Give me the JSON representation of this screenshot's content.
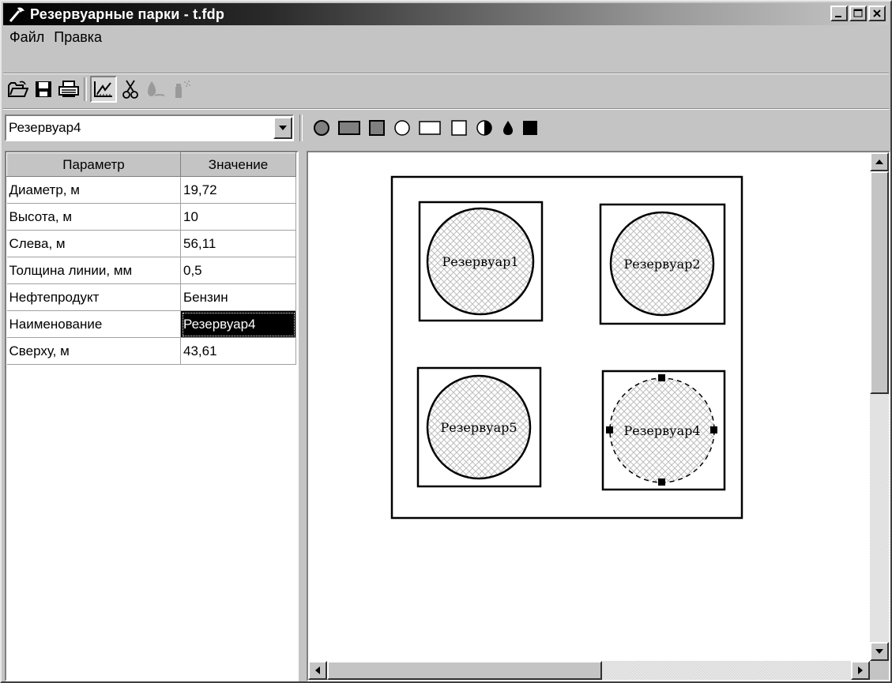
{
  "window": {
    "title": "Резервуарные парки - t.fdp"
  },
  "menu": [
    "Файл",
    "Правка"
  ],
  "toolbar": {
    "buttons": [
      "open-icon",
      "save-icon",
      "print-icon",
      "draw-mode-icon",
      "cut-icon",
      "fill-icon",
      "spray-icon"
    ]
  },
  "object_select": {
    "value": "Резервуар4"
  },
  "shape_palette": [
    "filled-circle",
    "filled-wide-rect",
    "filled-square",
    "hollow-circle",
    "hollow-wide-rect",
    "hollow-square",
    "half-circle",
    "drop",
    "black-square"
  ],
  "properties": {
    "headers": [
      "Параметр",
      "Значение"
    ],
    "rows": [
      {
        "param": "Диаметр, м",
        "value": "19,72"
      },
      {
        "param": "Высота, м",
        "value": "10"
      },
      {
        "param": "Слева, м",
        "value": "56,11"
      },
      {
        "param": "Толщина линии, мм",
        "value": "0,5"
      },
      {
        "param": "Нефтепродукт",
        "value": "Бензин"
      },
      {
        "param": "Наименование",
        "value": "Резервуар4"
      },
      {
        "param": "Сверху, м",
        "value": "43,61"
      }
    ]
  },
  "diagram": {
    "tanks": [
      {
        "label": "Резервуар1",
        "selected": false
      },
      {
        "label": "Резервуар2",
        "selected": false
      },
      {
        "label": "Резервуар5",
        "selected": false
      },
      {
        "label": "Резервуар4",
        "selected": true
      }
    ]
  },
  "colors": {
    "face": "#c4c4c4",
    "selection": "#000000",
    "title_gradient_start": "#000000"
  }
}
